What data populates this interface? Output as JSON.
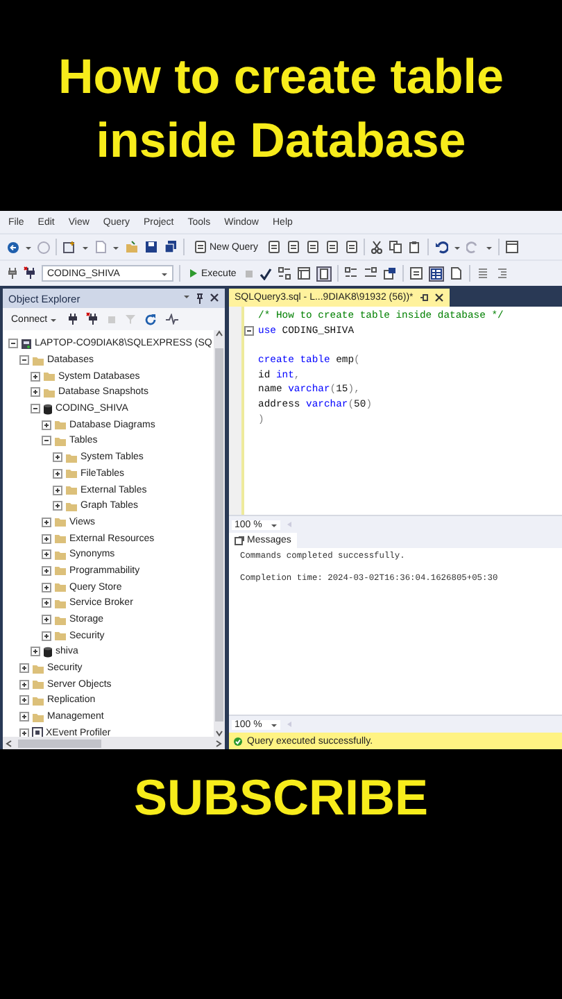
{
  "headline": [
    "How to create table",
    "inside Database"
  ],
  "menu": [
    "File",
    "Edit",
    "View",
    "Query",
    "Project",
    "Tools",
    "Window",
    "Help"
  ],
  "toolbar": {
    "new_query": "New Query",
    "database": "CODING_SHIVA",
    "execute": "Execute"
  },
  "object_explorer": {
    "title": "Object Explorer",
    "connect": "Connect",
    "tree": [
      {
        "label": "LAPTOP-CO9DIAK8\\SQLEXPRESS (SQ",
        "kind": "server",
        "expanded": true,
        "children": [
          {
            "label": "Databases",
            "kind": "folder",
            "expanded": true,
            "children": [
              {
                "label": "System Databases",
                "kind": "folder",
                "expanded": false
              },
              {
                "label": "Database Snapshots",
                "kind": "folder",
                "expanded": false
              },
              {
                "label": "CODING_SHIVA",
                "kind": "database",
                "expanded": true,
                "children": [
                  {
                    "label": "Database Diagrams",
                    "kind": "folder",
                    "expanded": false
                  },
                  {
                    "label": "Tables",
                    "kind": "folder",
                    "expanded": true,
                    "children": [
                      {
                        "label": "System Tables",
                        "kind": "folder",
                        "expanded": false
                      },
                      {
                        "label": "FileTables",
                        "kind": "folder",
                        "expanded": false
                      },
                      {
                        "label": "External Tables",
                        "kind": "folder",
                        "expanded": false
                      },
                      {
                        "label": "Graph Tables",
                        "kind": "folder",
                        "expanded": false
                      }
                    ]
                  },
                  {
                    "label": "Views",
                    "kind": "folder",
                    "expanded": false
                  },
                  {
                    "label": "External Resources",
                    "kind": "folder",
                    "expanded": false
                  },
                  {
                    "label": "Synonyms",
                    "kind": "folder",
                    "expanded": false
                  },
                  {
                    "label": "Programmability",
                    "kind": "folder",
                    "expanded": false
                  },
                  {
                    "label": "Query Store",
                    "kind": "folder",
                    "expanded": false
                  },
                  {
                    "label": "Service Broker",
                    "kind": "folder",
                    "expanded": false
                  },
                  {
                    "label": "Storage",
                    "kind": "folder",
                    "expanded": false
                  },
                  {
                    "label": "Security",
                    "kind": "folder",
                    "expanded": false
                  }
                ]
              },
              {
                "label": "shiva",
                "kind": "database",
                "expanded": false
              }
            ]
          },
          {
            "label": "Security",
            "kind": "folder",
            "expanded": false
          },
          {
            "label": "Server Objects",
            "kind": "folder",
            "expanded": false
          },
          {
            "label": "Replication",
            "kind": "folder",
            "expanded": false
          },
          {
            "label": "Management",
            "kind": "folder",
            "expanded": false
          },
          {
            "label": "XEvent Profiler",
            "kind": "profiler",
            "expanded": false
          }
        ]
      }
    ]
  },
  "editor": {
    "tab": "SQLQuery3.sql - L...9DIAK8\\91932 (56))*",
    "lines": [
      [
        {
          "text": "/* How to create table inside database */",
          "kind": "comment"
        }
      ],
      [
        {
          "text": "use",
          "kind": "keyword"
        },
        {
          "text": " CODING_SHIVA",
          "kind": "plain"
        }
      ],
      {
        "kind": "blank"
      },
      [
        {
          "text": "create table",
          "kind": "keyword"
        },
        {
          "text": " emp",
          "kind": "plain"
        },
        {
          "text": "(",
          "kind": "operator"
        }
      ],
      [
        {
          "text": "id ",
          "kind": "plain"
        },
        {
          "text": "int",
          "kind": "keyword"
        },
        {
          "text": ",",
          "kind": "operator"
        }
      ],
      [
        {
          "text": "name ",
          "kind": "plain"
        },
        {
          "text": "varchar",
          "kind": "keyword"
        },
        {
          "text": "(",
          "kind": "operator"
        },
        {
          "text": "15",
          "kind": "plain"
        },
        {
          "text": "),",
          "kind": "operator"
        }
      ],
      [
        {
          "text": "address ",
          "kind": "plain"
        },
        {
          "text": "varchar",
          "kind": "keyword"
        },
        {
          "text": "(",
          "kind": "operator"
        },
        {
          "text": "50",
          "kind": "plain"
        },
        {
          "text": ")",
          "kind": "operator"
        }
      ],
      [
        {
          "text": ")",
          "kind": "operator"
        }
      ]
    ],
    "zoom": "100 %"
  },
  "results": {
    "tab": "Messages",
    "messages": [
      "Commands completed successfully.",
      "Completion time: 2024-03-02T16:36:04.1626805+05:30"
    ],
    "zoom": "100 %"
  },
  "status_bar": {
    "message": "Query executed successfully."
  },
  "footer": "SUBSCRIBE"
}
